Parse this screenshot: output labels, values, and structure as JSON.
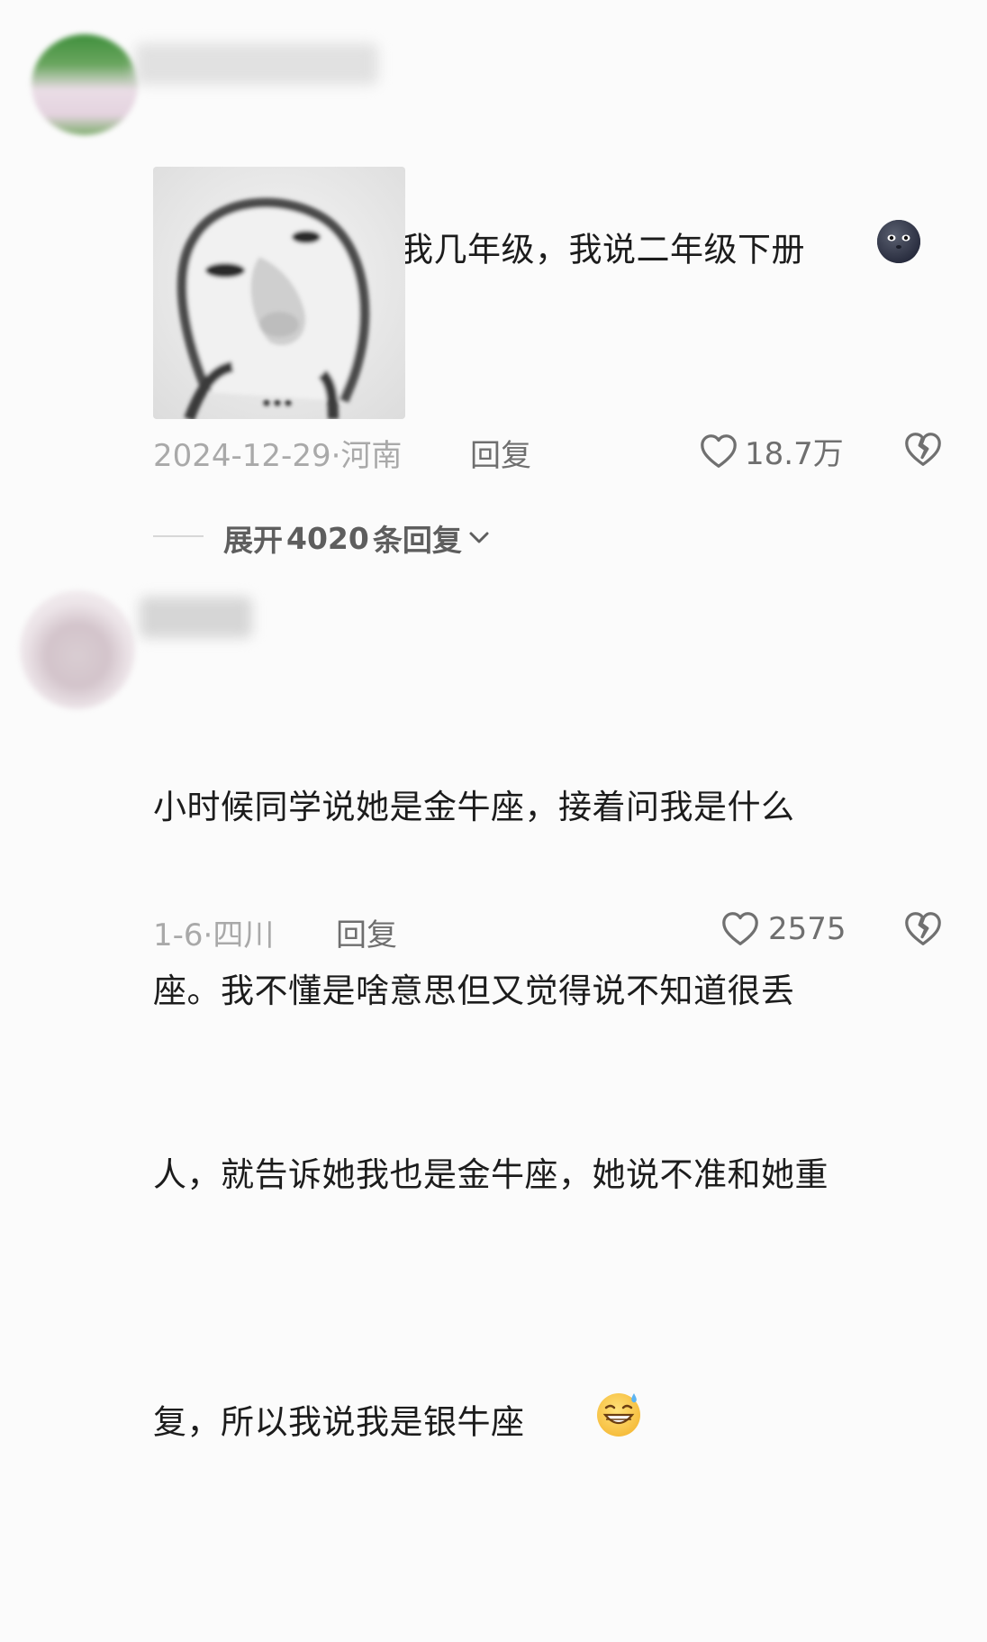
{
  "comments": [
    {
      "text": "小时候别人问我几年级，我说二年级下册",
      "emoji": "new-moon-face-emoji",
      "has_sticker": true,
      "date": "2024-12-29",
      "location": "河南",
      "reply_label": "回复",
      "likes": "18.7万"
    },
    {
      "text": "小时候同学说她是金牛座，接着问我是什么座。我不懂是啥意思但又觉得说不知道很丢人，就告诉她我也是金牛座，她说不准和她重复，所以我说我是银牛座",
      "lines": [
        "小时候同学说她是金牛座，接着问我是什么",
        "座。我不懂是啥意思但又觉得说不知道很丢",
        "人，就告诉她我也是金牛座，她说不准和她重",
        "复，所以我说我是银牛座"
      ],
      "emoji": "grinning-sweat-emoji",
      "date": "1-6",
      "location": "四川",
      "reply_label": "回复",
      "likes": "2575"
    }
  ],
  "expand_replies": {
    "prefix": "展开",
    "count": "4020",
    "suffix": "条回复"
  },
  "icons": {
    "like": "heart-outline-icon",
    "dislike": "broken-heart-icon",
    "expand": "chevron-down-icon"
  },
  "colors": {
    "background": "#fbfbfb",
    "text": "#1c1c1c",
    "meta": "#a9a9a9",
    "action": "#6f6f6f"
  }
}
